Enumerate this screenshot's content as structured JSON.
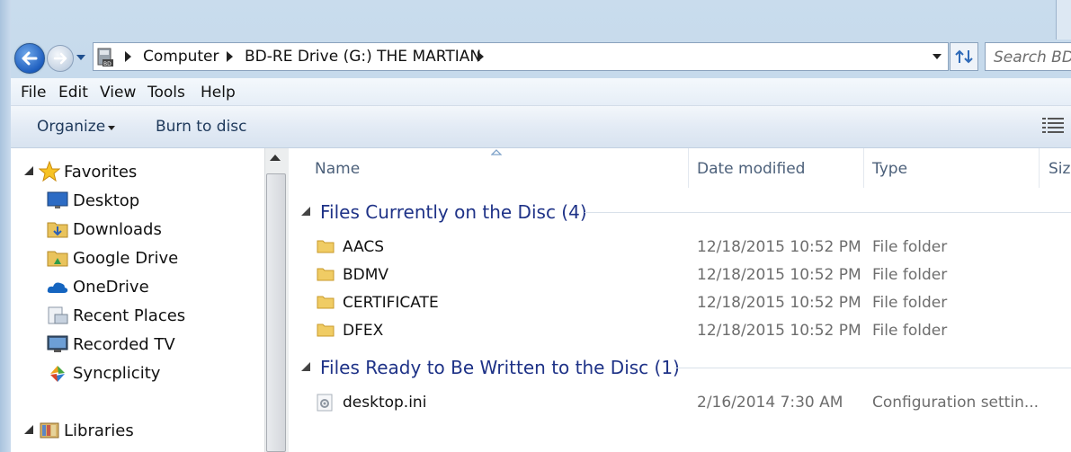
{
  "address": {
    "crumbs": [
      "Computer",
      "BD-RE Drive (G:) THE MARTIAN"
    ],
    "search_placeholder": "Search BD-"
  },
  "menu": [
    "File",
    "Edit",
    "View",
    "Tools",
    "Help"
  ],
  "commands": {
    "organize": "Organize",
    "burn": "Burn to disc"
  },
  "nav": {
    "favorites_label": "Favorites",
    "items": [
      "Desktop",
      "Downloads",
      "Google Drive",
      "OneDrive",
      "Recent Places",
      "Recorded TV",
      "Syncplicity"
    ],
    "libraries_label": "Libraries"
  },
  "columns": [
    "Name",
    "Date modified",
    "Type",
    "Size"
  ],
  "groups": [
    {
      "title": "Files Currently on the Disc (4)",
      "files": [
        {
          "name": "AACS",
          "date": "12/18/2015 10:52 PM",
          "type": "File folder"
        },
        {
          "name": "BDMV",
          "date": "12/18/2015 10:52 PM",
          "type": "File folder"
        },
        {
          "name": "CERTIFICATE",
          "date": "12/18/2015 10:52 PM",
          "type": "File folder"
        },
        {
          "name": "DFEX",
          "date": "12/18/2015 10:52 PM",
          "type": "File folder"
        }
      ]
    },
    {
      "title": "Files Ready to Be Written to the Disc (1)",
      "files": [
        {
          "name": "desktop.ini",
          "date": "2/16/2014 7:30 AM",
          "type": "Configuration settin..."
        }
      ]
    }
  ],
  "colors": {
    "group_title": "#1e3287",
    "secondary_text": "#6d6d6d",
    "accent": "#1f5fbf"
  }
}
